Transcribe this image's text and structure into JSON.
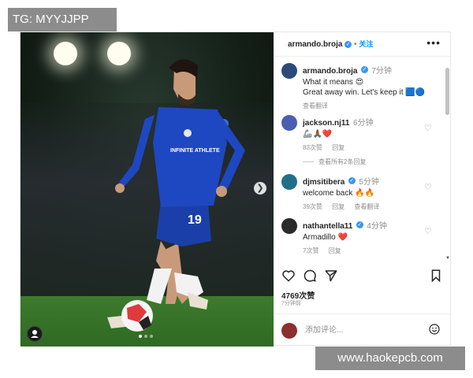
{
  "watermarks": {
    "top_left": "TG: MYYJJPP",
    "bottom_right": "www.haokepcb.com"
  },
  "photo": {
    "jersey_sponsor": "INFINITE ATHLETE",
    "jersey_number": "19",
    "carousel_dots": 3,
    "active_dot": 0
  },
  "header": {
    "username": "armando.broja",
    "follow_label": "关注",
    "more_icon": "more-horizontal-icon"
  },
  "comments": [
    {
      "username": "armando.broja",
      "time": "7分钟",
      "lines": [
        "What it means 😍",
        "Great away win. Let's keep it 🟦🔵"
      ],
      "meta": [
        "查看翻译"
      ],
      "avatar_color": "#2b4a7a",
      "verified": true,
      "heart": false
    },
    {
      "username": "jackson.nj11",
      "time": "6分钟",
      "lines": [
        "🦾🙏🏾❤️"
      ],
      "meta": [
        "83次赞",
        "回复"
      ],
      "avatar_color": "#4a5fb0",
      "verified": false,
      "heart": true
    },
    {
      "username": "djmsitibera",
      "time": "5分钟",
      "lines": [
        "welcome back 🔥🔥"
      ],
      "meta": [
        "39次赞",
        "回复",
        "查看翻译"
      ],
      "avatar_color": "#1f6f8b",
      "verified": true,
      "heart": true
    },
    {
      "username": "nathantella11",
      "time": "4分钟",
      "lines": [
        "Armadillo ❤️"
      ],
      "meta": [
        "7次赞",
        "回复"
      ],
      "avatar_color": "#2a2a2a",
      "verified": true,
      "heart": true
    }
  ],
  "view_replies": "查看所有2条回复",
  "likes": "4769次赞",
  "post_time": "7分钟前",
  "comment_box": {
    "placeholder": "添加评论..."
  },
  "colors": {
    "verified": "#3897f0",
    "follow": "#0095f6",
    "heart_red": "#ed4956"
  }
}
